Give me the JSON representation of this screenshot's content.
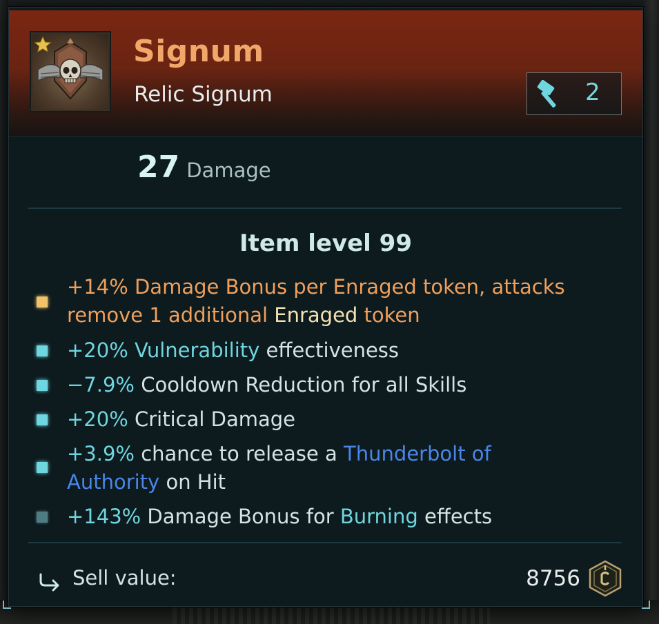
{
  "item": {
    "name": "Signum",
    "type": "Relic Signum",
    "tier": "2",
    "damage_value": "27",
    "damage_label": "Damage",
    "item_level": "Item level 99",
    "icon": "skull-winged-emblem-icon",
    "rarity_icon": "star-icon",
    "tier_icon": "hammer-icon"
  },
  "colors": {
    "title": "#f2a76a",
    "orange_affix": "#f0a05c",
    "cyan_affix": "#6fd6df",
    "blue_link": "#4a86e8",
    "header_bg": "#7a2612",
    "panel_bg": "#0d1a1e"
  },
  "affixes": [
    {
      "bullet_color": "#f2c26a",
      "line1": [
        "+14% Damage Bonus per Enraged token, attacks"
      ],
      "line2a": "remove 1 additional ",
      "line2b": "Enraged",
      "line2c": " token"
    },
    {
      "value": "+20%",
      "keyword": " Vulnerability",
      "rest": " effectiveness"
    },
    {
      "value": "−7.9%",
      "rest": " Cooldown Reduction for all Skills"
    },
    {
      "value": "+20%",
      "rest": " Critical Damage"
    },
    {
      "value": "+3.9%",
      "rest": " chance to release a ",
      "link1": "Thunderbolt of",
      "link2": "Authority",
      "rest2": " on Hit"
    },
    {
      "value": "+143%",
      "rest": " Damage Bonus for ",
      "keyword": "Burning",
      "rest2": " effects"
    }
  ],
  "sell": {
    "label": "Sell value:",
    "value": "8756",
    "icon": "return-arrow-icon",
    "currency_icon": "credit-coin-icon"
  }
}
